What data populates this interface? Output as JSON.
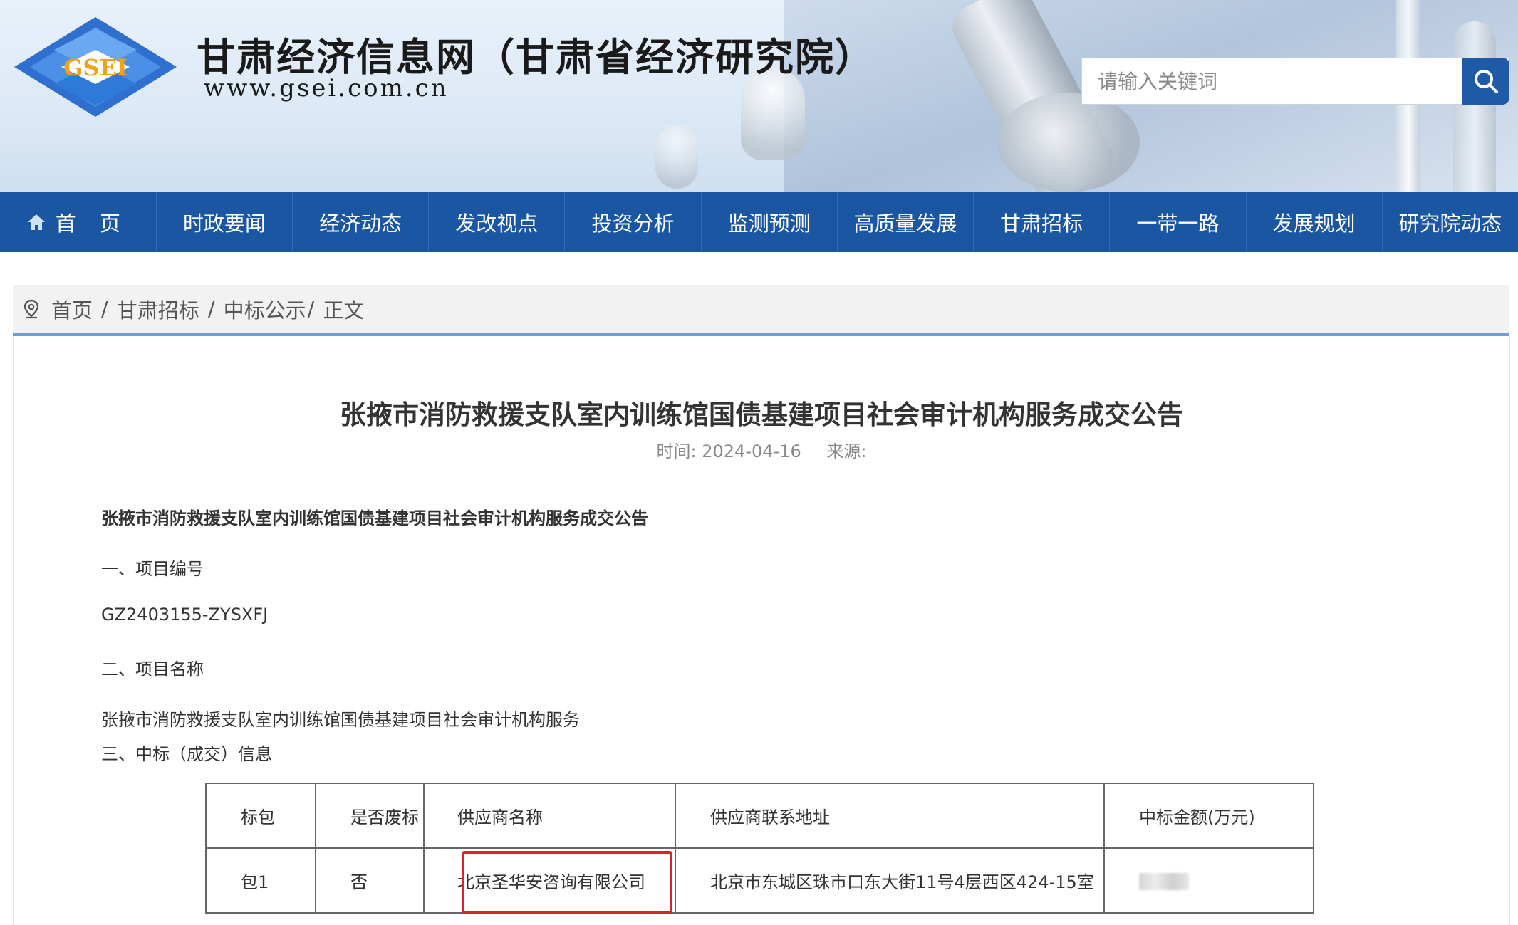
{
  "header": {
    "logo_text": "GSEI",
    "site_title": "甘肃经济信息网（甘肃省经济研究院）",
    "site_url": "www.gsei.com.cn",
    "search": {
      "placeholder": "请输入关键词",
      "icon": "search-icon"
    },
    "colors": {
      "nav_bg": "#1b56a3",
      "search_btn": "#1f5aa6"
    }
  },
  "nav": {
    "items": [
      {
        "label": "首 页",
        "icon": "home-icon"
      },
      {
        "label": "时政要闻"
      },
      {
        "label": "经济动态"
      },
      {
        "label": "发改视点"
      },
      {
        "label": "投资分析"
      },
      {
        "label": "监测预测"
      },
      {
        "label": "高质量发展"
      },
      {
        "label": "甘肃招标"
      },
      {
        "label": "一带一路"
      },
      {
        "label": "发展规划"
      },
      {
        "label": "研究院动态"
      }
    ]
  },
  "breadcrumb": {
    "icon": "location-pin-icon",
    "items": [
      "首页",
      "甘肃招标",
      "中标公示",
      "正文"
    ],
    "separator": "/"
  },
  "article": {
    "title": "张掖市消防救援支队室内训练馆国债基建项目社会审计机构服务成交公告",
    "time_label": "时间:",
    "time": "2024-04-16",
    "source_label": "来源:",
    "source": "",
    "body_title": "张掖市消防救援支队室内训练馆国债基建项目社会审计机构服务成交公告",
    "section1_heading": "一、项目编号",
    "project_number": "GZ2403155-ZYSXFJ",
    "section2_heading": "二、项目名称",
    "project_name": "张掖市消防救援支队室内训练馆国债基建项目社会审计机构服务",
    "section3_heading": "三、中标（成交）信息"
  },
  "table": {
    "headers": [
      "标包",
      "是否废标",
      "供应商名称",
      "供应商联系地址",
      "中标金额(万元)"
    ],
    "rows": [
      [
        "包1",
        "否",
        "北京圣华安咨询有限公司",
        "北京市东城区珠市口东大街11号4层西区424-15室",
        ""
      ]
    ],
    "highlight_color": "#e0202a"
  }
}
